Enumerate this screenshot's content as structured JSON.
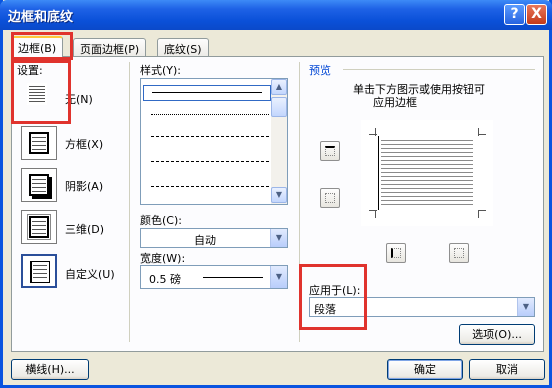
{
  "window": {
    "title": "边框和底纹"
  },
  "tabs": [
    {
      "label": "边框(B)"
    },
    {
      "label": "页面边框(P)"
    },
    {
      "label": "底纹(S)"
    }
  ],
  "settings": {
    "heading": "设置:",
    "items": [
      {
        "label": "无(N)",
        "icon": "none-border-icon"
      },
      {
        "label": "方框(X)",
        "icon": "box-border-icon"
      },
      {
        "label": "阴影(A)",
        "icon": "shadow-border-icon"
      },
      {
        "label": "三维(D)",
        "icon": "3d-border-icon"
      },
      {
        "label": "自定义(U)",
        "icon": "custom-border-icon"
      }
    ]
  },
  "style": {
    "heading": "样式(Y):",
    "items": [
      "solid",
      "dotted-fine",
      "dashed-short",
      "dashed",
      "dash-dot",
      "dash-dot-dot"
    ]
  },
  "color": {
    "label": "颜色(C):",
    "value": "自动"
  },
  "width": {
    "label": "宽度(W):",
    "value": "0.5 磅"
  },
  "preview": {
    "heading": "预览",
    "hint_line1": "单击下方图示或使用按钮可",
    "hint_line2": "应用边框"
  },
  "apply_to": {
    "label": "应用于(L):",
    "value": "段落"
  },
  "buttons": {
    "options": "选项(O)...",
    "horizontal_line": "横线(H)...",
    "ok": "确定",
    "cancel": "取消"
  },
  "titlebar_buttons": {
    "help": "?",
    "close": "X"
  }
}
